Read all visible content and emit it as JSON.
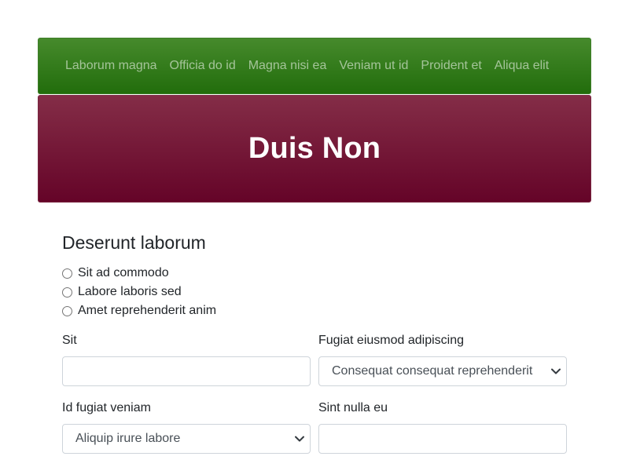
{
  "nav": {
    "items": [
      "Laborum magna",
      "Officia do id",
      "Magna nisi ea",
      "Veniam ut id",
      "Proident et",
      "Aliqua elit"
    ]
  },
  "hero": {
    "title": "Duis Non"
  },
  "section": {
    "title": "Deserunt laborum"
  },
  "radios": [
    "Sit ad commodo",
    "Labore laboris sed",
    "Amet reprehenderit anim"
  ],
  "fields": {
    "sit": {
      "label": "Sit",
      "value": ""
    },
    "fugiat": {
      "label": "Fugiat eiusmod adipiscing",
      "selected": "Consequat consequat reprehenderit"
    },
    "id_fugiat": {
      "label": "Id fugiat veniam",
      "selected": "Aliquip irure labore"
    },
    "sint": {
      "label": "Sint nulla eu",
      "value": ""
    }
  },
  "colors": {
    "navbar": "#2f7b1a",
    "hero": "#74183a",
    "text": "#212529",
    "border": "#ced4da"
  },
  "icons": {
    "select_arrow": "chevron-down-icon",
    "radio": "radio-unchecked-icon"
  }
}
